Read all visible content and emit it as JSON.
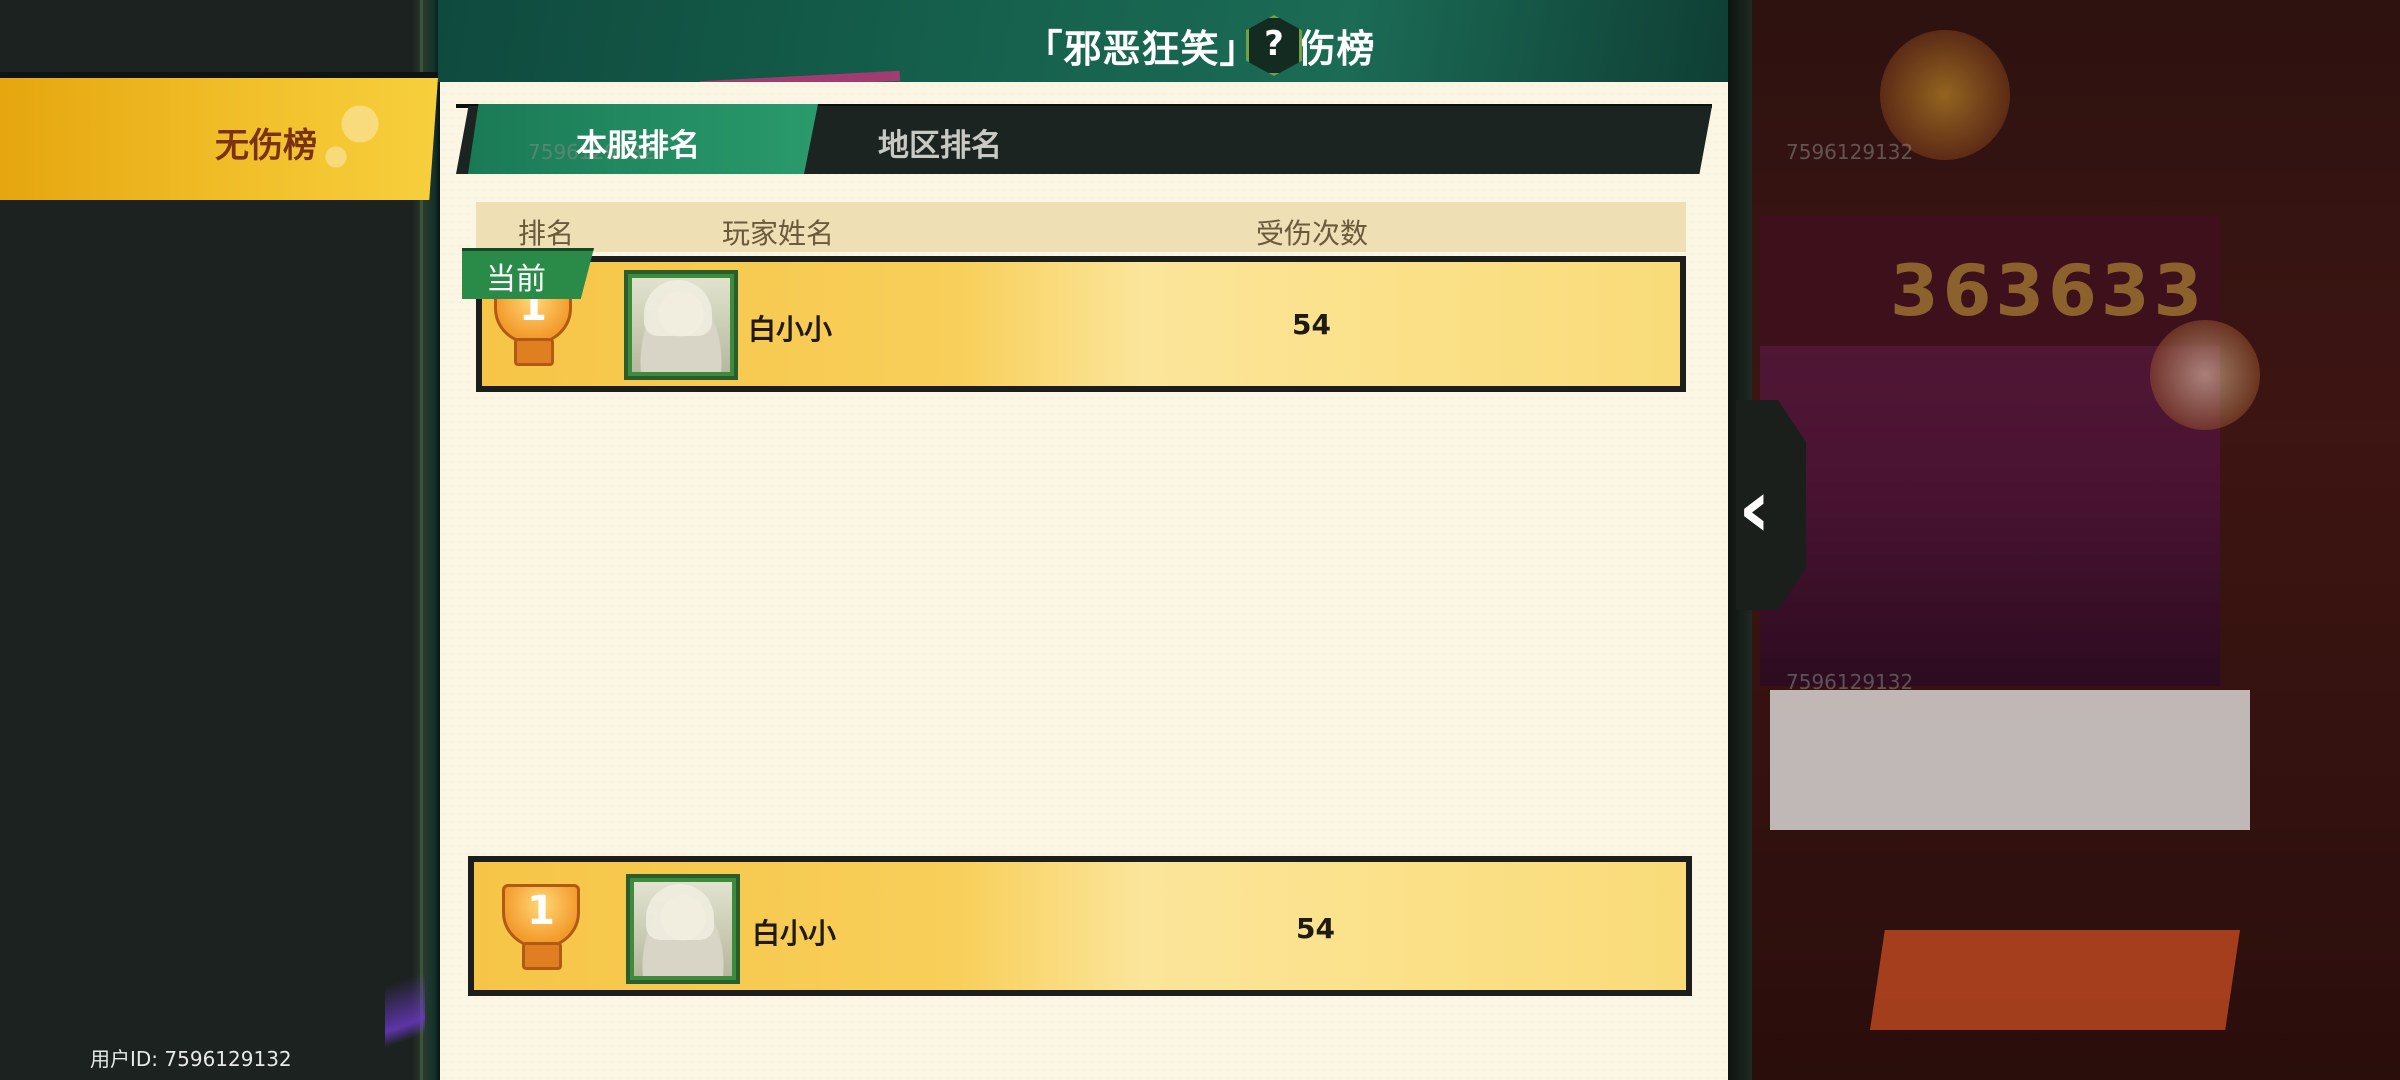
{
  "sidebar": {
    "active_tab_label": "无伤榜",
    "user_id_label": "用户ID: 7596129132"
  },
  "title": "「邪恶狂笑」无伤榜",
  "help_glyph": "?",
  "tabs": [
    {
      "label": "本服排名",
      "active": true
    },
    {
      "label": "地区排名",
      "active": false
    }
  ],
  "watermark": "7596129132",
  "table": {
    "columns": [
      "排名",
      "玩家姓名",
      "受伤次数"
    ],
    "rows": [
      {
        "rank": "1",
        "badge": "当前",
        "player": "白小小",
        "damage_count": "54"
      }
    ]
  },
  "my_entry": {
    "rank": "1",
    "player": "白小小",
    "damage_count": "54"
  },
  "background_score": "363633",
  "colors": {
    "accent_green": "#2a9a6c",
    "tab_yellow": "#f2c12c",
    "row_gold": "#f8cf5a",
    "panel_cream": "#faf6e3"
  }
}
